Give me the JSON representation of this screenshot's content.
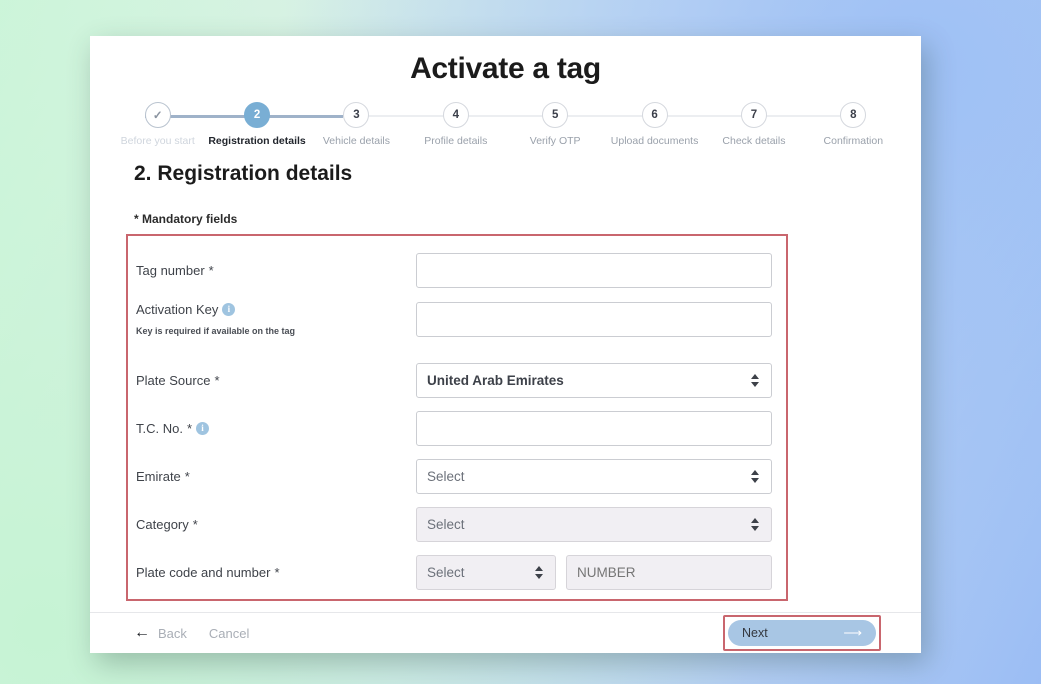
{
  "page": {
    "title": "Activate a tag",
    "section_heading": "2. Registration details",
    "mandatory_note": "* Mandatory fields"
  },
  "stepper": {
    "steps": [
      {
        "number": "✓",
        "label": "Before you start",
        "state": "done"
      },
      {
        "number": "2",
        "label": "Registration details",
        "state": "active"
      },
      {
        "number": "3",
        "label": "Vehicle details",
        "state": "upcoming"
      },
      {
        "number": "4",
        "label": "Profile details",
        "state": "upcoming"
      },
      {
        "number": "5",
        "label": "Verify OTP",
        "state": "upcoming"
      },
      {
        "number": "6",
        "label": "Upload documents",
        "state": "upcoming"
      },
      {
        "number": "7",
        "label": "Check details",
        "state": "upcoming"
      },
      {
        "number": "8",
        "label": "Confirmation",
        "state": "upcoming"
      }
    ]
  },
  "form": {
    "fields": {
      "tag_number": {
        "label": "Tag number",
        "required": "*",
        "value": "",
        "placeholder": ""
      },
      "activation_key": {
        "label": "Activation Key",
        "required": "",
        "info_icon": "info-icon",
        "hint": "Key is required if available on the tag",
        "value": "",
        "placeholder": ""
      },
      "plate_source": {
        "label": "Plate Source",
        "required": "*",
        "value": "United Arab Emirates"
      },
      "tc_no": {
        "label": "T.C. No.",
        "required": "*",
        "info_icon": "info-icon",
        "value": "",
        "placeholder": ""
      },
      "emirate": {
        "label": "Emirate",
        "required": "*",
        "value": "Select"
      },
      "category": {
        "label": "Category",
        "required": "*",
        "value": "Select"
      },
      "plate_code_and_number": {
        "label": "Plate code and number",
        "required": "*",
        "code_value": "Select",
        "number_placeholder": "NUMBER",
        "number_value": ""
      }
    }
  },
  "footer": {
    "back_label": "Back",
    "back_arrow": "←",
    "cancel_label": "Cancel",
    "next_label": "Next",
    "next_arrow": "⟶"
  },
  "colors": {
    "accent_blue": "#79aed4",
    "highlight_red": "#c9666e",
    "next_button_bg": "#a8c6e4",
    "info_icon_bg": "#9fc4e0",
    "muted_field_bg": "#f1eff3"
  }
}
